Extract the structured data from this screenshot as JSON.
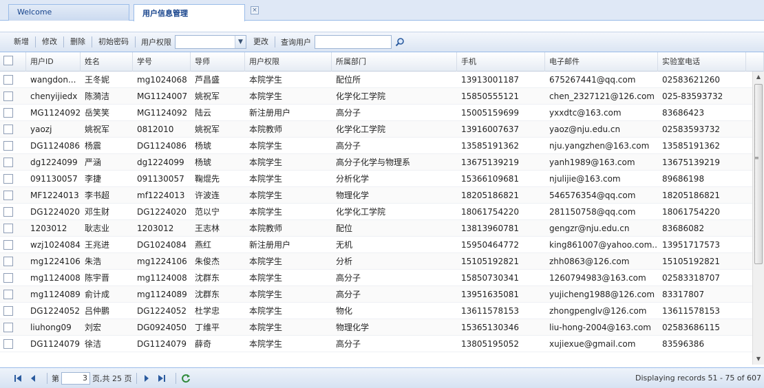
{
  "tabs": [
    {
      "label": "Welcome"
    },
    {
      "label": "用户信息管理"
    }
  ],
  "tab_close": "×",
  "toolbar": {
    "add": "新增",
    "edit": "修改",
    "delete": "删除",
    "init_password": "初始密码",
    "user_permission_label": "用户权限",
    "user_permission_value": "",
    "change": "更改",
    "query_user_label": "查询用户",
    "query_user_value": ""
  },
  "columns": [
    "用户ID",
    "姓名",
    "学号",
    "导师",
    "用户权限",
    "所属部门",
    "手机",
    "电子邮件",
    "实验室电话"
  ],
  "rows": [
    [
      "wangdon...",
      "王冬妮",
      "mg1024068",
      "芦昌盛",
      "本院学生",
      "配位所",
      "13913001187",
      "675267441@qq.com",
      "02583621260"
    ],
    [
      "chenyijiedx",
      "陈漪洁",
      "MG1124007",
      "姚祝军",
      "本院学生",
      "化学化工学院",
      "15850555121",
      "chen_2327121@126.com",
      "025-83593732"
    ],
    [
      "MG1124092",
      "岳笑笑",
      "MG1124092",
      "陆云",
      "新注册用户",
      "高分子",
      "15005159699",
      "yxxdtc@163.com",
      "83686423"
    ],
    [
      "yaozj",
      "姚祝军",
      "0812010",
      "姚祝军",
      "本院教师",
      "化学化工学院",
      "13916007637",
      "yaoz@nju.edu.cn",
      "02583593732"
    ],
    [
      "DG1124086",
      "杨震",
      "DG1124086",
      "杨琥",
      "本院学生",
      "高分子",
      "13585191362",
      "nju.yangzhen@163.com",
      "13585191362"
    ],
    [
      "dg1224099",
      "严涵",
      "dg1224099",
      "杨琥",
      "本院学生",
      "高分子化学与物理系",
      "13675139219",
      "yanh1989@163.com",
      "13675139219"
    ],
    [
      "091130057",
      "李捷",
      "091130057",
      "鞠焜先",
      "本院学生",
      "分析化学",
      "15366109681",
      "njulijie@163.com",
      "89686198"
    ],
    [
      "MF1224013",
      "李书超",
      "mf1224013",
      "许波连",
      "本院学生",
      "物理化学",
      "18205186821",
      "546576354@qq.com",
      "18205186821"
    ],
    [
      "DG1224020",
      "邓生财",
      "DG1224020",
      "范以宁",
      "本院学生",
      "化学化工学院",
      "18061754220",
      "281150758@qq.com",
      "18061754220"
    ],
    [
      "1203012",
      "耿志业",
      "1203012",
      "王志林",
      "本院教师",
      "配位",
      "13813960781",
      "gengzr@nju.edu.cn",
      "83686082"
    ],
    [
      "wzj1024084",
      "王兆进",
      "DG1024084",
      "燕红",
      "新注册用户",
      "无机",
      "15950464772",
      "king861007@yahoo.com...",
      "13951717573"
    ],
    [
      "mg1224106",
      "朱浩",
      "mg1224106",
      "朱俊杰",
      "本院学生",
      "分析",
      "15105192821",
      "zhh0863@126.com",
      "15105192821"
    ],
    [
      "mg1124008",
      "陈宇晋",
      "mg1124008",
      "沈群东",
      "本院学生",
      "高分子",
      "15850730341",
      "1260794983@163.com",
      "02583318707"
    ],
    [
      "mg1124089",
      "俞计成",
      "mg1124089",
      "沈群东",
      "本院学生",
      "高分子",
      "13951635081",
      "yujicheng1988@126.com",
      "83317807"
    ],
    [
      "DG1224052",
      "吕仲鹏",
      "DG1224052",
      "杜学忠",
      "本院学生",
      "物化",
      "13611578153",
      "zhongpenglv@126.com",
      "13611578153"
    ],
    [
      "liuhong09",
      "刘宏",
      "DG0924050",
      "丁维平",
      "本院学生",
      "物理化学",
      "15365130346",
      "liu-hong-2004@163.com",
      "02583686115"
    ],
    [
      "DG1124079",
      "徐洁",
      "DG1124079",
      "薛奇",
      "本院学生",
      "高分子",
      "13805195052",
      "xujiexue@gmail.com",
      "83596386"
    ]
  ],
  "pager": {
    "page_label": "第",
    "page_value": "3",
    "page_suffix": "页,共 25 页",
    "display": "Displaying records 51 - 75 of 607"
  },
  "colors": {
    "accent": "#99bbe8",
    "tab_text": "#15428b"
  }
}
